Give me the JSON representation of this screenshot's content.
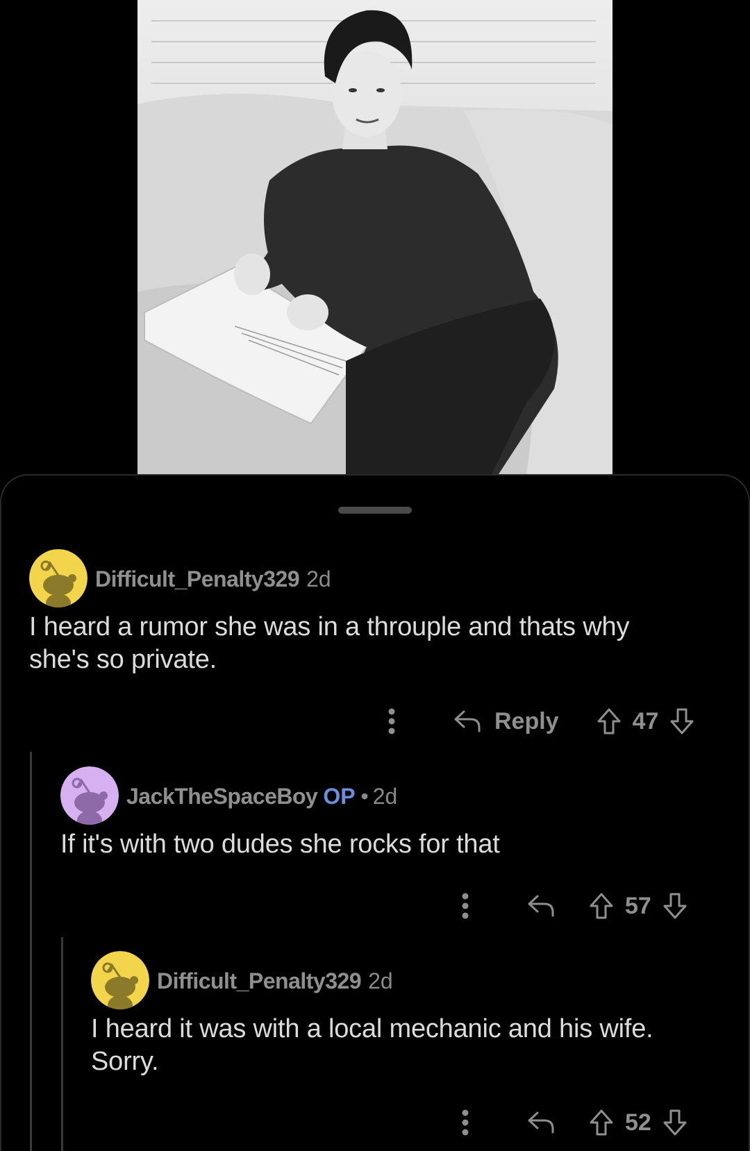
{
  "comments": [
    {
      "username": "Difficult_Penalty329",
      "age": "2d",
      "text": "I heard a rumor she was in a throuple and thats why she's so private.",
      "reply_label": "Reply",
      "votes": "47",
      "avatar_color": "#f2d54a"
    },
    {
      "username": "JackTheSpaceBoy",
      "badge": "OP",
      "separator": "•",
      "age": "2d",
      "text": "If it's with two dudes she rocks for that",
      "votes": "57",
      "avatar_color": "#d6b0f0"
    },
    {
      "username": "Difficult_Penalty329",
      "age": "2d",
      "text_line1": "I heard it was with a local mechanic and his wife.",
      "text_line2": "Sorry.",
      "votes": "52",
      "avatar_color": "#f2d54a"
    }
  ],
  "colors": {
    "background": "#000000",
    "text": "#dcdcdc",
    "meta": "#8a8a8a",
    "op_badge": "#6c8ee0"
  }
}
